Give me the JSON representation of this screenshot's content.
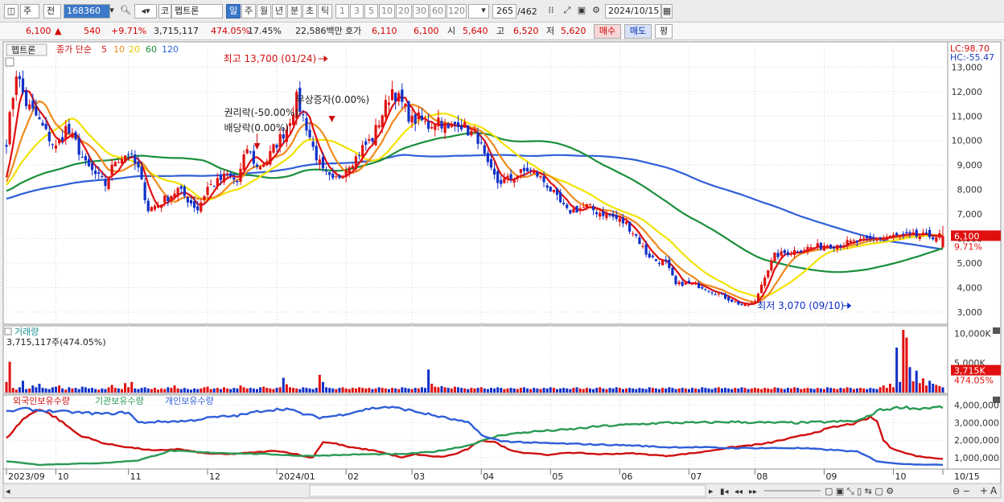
{
  "toolbar": {
    "market": "주",
    "type": "전",
    "code": "168360",
    "kind": "코",
    "name": "펩트론",
    "periods": [
      "일",
      "주",
      "월",
      "년",
      "분",
      "초",
      "틱"
    ],
    "minutes": [
      "1",
      "3",
      "5",
      "10",
      "20",
      "30",
      "60",
      "120"
    ],
    "count": "265",
    "total": "/462",
    "date": "2024/10/15"
  },
  "quote": {
    "price": "6,100",
    "arrow": "▲",
    "change": "540",
    "rate": "+9.71%",
    "volume": "3,715,117",
    "vol_ratio": "474.05%",
    "turnover": "17.45%",
    "amount": "22,586백만",
    "hoga_label": "호가",
    "ask": "6,110",
    "bid": "6,100",
    "open_label": "시",
    "open": "5,640",
    "high_label": "고",
    "high": "6,520",
    "low_label": "저",
    "low": "5,620",
    "buy": "매수",
    "sell": "매도",
    "eval": "평"
  },
  "legend": {
    "name": "펩트론",
    "ma_label": "종가 단순",
    "ma": [
      {
        "name": "5",
        "color": "#e01010"
      },
      {
        "name": "10",
        "color": "#f08a1c"
      },
      {
        "name": "20",
        "color": "#f2e200"
      },
      {
        "name": "60",
        "color": "#1a8f3a"
      },
      {
        "name": "120",
        "color": "#2f5fd8"
      }
    ]
  },
  "colors": {
    "up": "#e01010",
    "down": "#1030c8",
    "ma5": "#e01010",
    "ma10": "#f08a1c",
    "ma20": "#f2e200",
    "ma60": "#1a8f3a",
    "ma120": "#2f5fd8",
    "foreign": "#d01010",
    "inst": "#2a9a55",
    "retail": "#2f5fd8"
  },
  "chart_data": [
    {
      "type": "candlestick",
      "title": "",
      "ylim": [
        2600,
        13900
      ],
      "yticks": [
        "13,000",
        "12,000",
        "11,000",
        "10,000",
        "9,000",
        "8,000",
        "7,000",
        "6,000",
        "5,000",
        "4,000",
        "3,000"
      ],
      "ytick_values": [
        13000,
        12000,
        11000,
        10000,
        9000,
        8000,
        7000,
        6000,
        5000,
        4000,
        3000
      ],
      "x_months": [
        "2023/09",
        "10",
        "11",
        "12",
        "2024/01",
        "02",
        "03",
        "04",
        "05",
        "06",
        "07",
        "08",
        "09",
        "10",
        "10/15"
      ],
      "month_values": [
        0,
        15,
        37,
        61,
        82,
        103,
        123,
        144,
        165,
        186,
        207,
        227,
        248,
        269,
        284
      ],
      "price_anchors": {
        "x": [
          0,
          3,
          6,
          9,
          12,
          15,
          18,
          21,
          24,
          27,
          30,
          33,
          37,
          40,
          43,
          46,
          49,
          52,
          55,
          58,
          61,
          64,
          67,
          70,
          73,
          76,
          79,
          82,
          85,
          88,
          91,
          93,
          96,
          99,
          102,
          104,
          106,
          108,
          111,
          114,
          117,
          120,
          123,
          125,
          128,
          131,
          134,
          137,
          140,
          143,
          146,
          149,
          152,
          155,
          158,
          161,
          164,
          167,
          170,
          173,
          176,
          179,
          182,
          185,
          188,
          191,
          194,
          197,
          200,
          203,
          206,
          209,
          212,
          215,
          218,
          221,
          224,
          227,
          230,
          233,
          236,
          239,
          242,
          245,
          248,
          251,
          254,
          257,
          260,
          262,
          264,
          266,
          268,
          270,
          272,
          274,
          276,
          278
        ],
        "y": [
          10000,
          12800,
          11500,
          11000,
          10300,
          9700,
          10500,
          9900,
          9000,
          8600,
          8200,
          9200,
          9500,
          8800,
          7200,
          7400,
          7700,
          8000,
          7600,
          7200,
          8100,
          8300,
          8600,
          8300,
          9700,
          8900,
          9200,
          9900,
          10500,
          11700,
          10600,
          9700,
          8700,
          8300,
          8700,
          9100,
          9300,
          9700,
          10100,
          11100,
          12100,
          11500,
          10800,
          10900,
          10600,
          10900,
          10400,
          10800,
          10400,
          10100,
          8900,
          8300,
          8400,
          8600,
          8800,
          8600,
          8200,
          7600,
          7100,
          7200,
          7300,
          7100,
          7000,
          6800,
          6600,
          6100,
          5400,
          5100,
          5000,
          4100,
          4200,
          4100,
          4000,
          3800,
          3600,
          3400,
          3250,
          3400,
          4500,
          5300,
          5400,
          5500,
          5600,
          5650,
          5700,
          5750,
          5800,
          5850,
          5900,
          5950,
          6000,
          6050,
          6100,
          6080,
          6090,
          6100,
          6100,
          6100
        ]
      },
      "last_price": "6,100",
      "last_rate": "9.71%",
      "annotations": [
        {
          "text": "최고 13,700 (01/24)",
          "x": 97,
          "y": 13700,
          "value": 13700,
          "date": "01/24"
        },
        {
          "text": "무상증자(0.00%)",
          "x": 97,
          "y": 11900
        },
        {
          "text": "권리락(-50.00%)",
          "x": 76,
          "y": 10900
        },
        {
          "text": "배당락(0.00%)",
          "x": 76,
          "y": 10100
        },
        {
          "text": "최저 3,070 (09/10)",
          "x": 256,
          "y": 3070,
          "value": 3070,
          "date": "09/10"
        }
      ],
      "lc": "LC:98.70",
      "hc": "HC:-55.47",
      "series": [
        {
          "name": "5"
        },
        {
          "name": "10"
        },
        {
          "name": "20"
        },
        {
          "name": "60"
        },
        {
          "name": "120"
        }
      ]
    },
    {
      "type": "bar",
      "title": "거래량",
      "info": "3,715,117주(474.05%)",
      "yticks": [
        "10,000K",
        "5,000K"
      ],
      "ytick_values": [
        10000,
        5000
      ],
      "ylim": [
        0,
        10600
      ],
      "last_label": "3,715K",
      "last_rate": "474.05%",
      "values_k": [
        1800,
        5200,
        800,
        500,
        900,
        2000,
        600,
        700,
        1200,
        900,
        1500,
        800,
        700,
        600,
        900,
        1000,
        1200,
        700,
        500,
        900,
        700,
        800,
        600,
        1000,
        900,
        700,
        800,
        600,
        500,
        700,
        600,
        900,
        1300,
        800,
        700,
        600,
        1600,
        900,
        1800,
        700,
        600,
        800,
        900,
        700,
        600,
        800,
        500,
        700,
        600,
        900,
        800,
        1200,
        700,
        600,
        800,
        600,
        500,
        700,
        600,
        700,
        900,
        1000,
        600,
        700,
        800,
        600,
        900,
        700,
        600,
        800,
        700,
        1200,
        900,
        700,
        800,
        700,
        600,
        900,
        1000,
        800,
        700,
        600,
        800,
        900,
        2500,
        1400,
        900,
        800,
        700,
        600,
        900,
        800,
        700,
        600,
        800,
        3000,
        1800,
        900,
        800,
        700,
        600,
        800,
        900,
        700,
        600,
        800,
        700,
        900,
        800,
        700,
        800,
        600,
        700,
        900,
        800,
        700,
        600,
        800,
        700,
        600,
        900,
        800,
        700,
        600,
        800,
        700,
        900,
        800,
        3900,
        1500,
        1000,
        900,
        1100,
        900,
        800,
        700,
        1000,
        900,
        800,
        700,
        600,
        800,
        700,
        800,
        900,
        700,
        600,
        800,
        700,
        900,
        800,
        600,
        700,
        800,
        700,
        600,
        800,
        900,
        700,
        600,
        800,
        700,
        600,
        800,
        700,
        900,
        800,
        600,
        700,
        800,
        700,
        600,
        800,
        900,
        700,
        600,
        800,
        700,
        600,
        800,
        900,
        700,
        600,
        800,
        700,
        900,
        800,
        600,
        700,
        800,
        700,
        600,
        800,
        700,
        600,
        900,
        800,
        700,
        600,
        800,
        700,
        900,
        800,
        600,
        700,
        800,
        700,
        600,
        800,
        700,
        600,
        900,
        800,
        700,
        600,
        800,
        900,
        700,
        800,
        700,
        600,
        800,
        700,
        900,
        800,
        600,
        700,
        800,
        700,
        600,
        800,
        700,
        600,
        900,
        800,
        700,
        600,
        800,
        700,
        900,
        800,
        600,
        700,
        800,
        700,
        600,
        800,
        700,
        600,
        900,
        800,
        700,
        600,
        800,
        700,
        900,
        800,
        600,
        700,
        800,
        700,
        600,
        800,
        700,
        600,
        900,
        1200,
        800,
        1500,
        900,
        7600,
        1800,
        10600,
        9300,
        4300,
        1900,
        3700,
        1600,
        2400,
        1200,
        2000,
        1500,
        1300,
        1100,
        900,
        1000,
        1200,
        3715
      ]
    },
    {
      "type": "line",
      "title": "",
      "legend": [
        "외국인보유수량",
        "기관보유수량",
        "개인보유수량"
      ],
      "yticks": [
        "4,000,000",
        "3,000,000",
        "2,000,000",
        "1,000,000"
      ],
      "ytick_values": [
        4000000,
        3000000,
        2000000,
        1000000
      ],
      "ylim": [
        400000,
        4400000
      ],
      "series": [
        {
          "name": "외국인보유수량",
          "x": [
            0,
            5,
            10,
            15,
            22,
            30,
            37,
            45,
            52,
            60,
            67,
            75,
            82,
            88,
            92,
            93,
            96,
            100,
            104,
            108,
            112,
            116,
            120,
            124,
            128,
            132,
            136,
            140,
            144,
            148,
            152,
            156,
            160,
            165,
            170,
            180,
            190,
            200,
            210,
            220,
            230,
            240,
            250,
            258,
            262,
            264,
            266,
            268,
            272,
            276,
            280,
            284
          ],
          "y": [
            2100000,
            3200000,
            3800000,
            3300000,
            2300000,
            1800000,
            1600000,
            1400000,
            1500000,
            1250000,
            1200000,
            1300000,
            1400000,
            1200000,
            1000000,
            1050000,
            1900000,
            1800000,
            1600000,
            1500000,
            1400000,
            1200000,
            1000000,
            1200000,
            1100000,
            1050000,
            1200000,
            1500000,
            2000000,
            1900000,
            1500000,
            1300000,
            1250000,
            1150000,
            1300000,
            1200000,
            1250000,
            1100000,
            1300000,
            1600000,
            1800000,
            2200000,
            2700000,
            3000000,
            3300000,
            3100000,
            2000000,
            1600000,
            1300000,
            1100000,
            1000000,
            950000
          ]
        },
        {
          "name": "기관보유수량",
          "x": [
            0,
            10,
            20,
            30,
            40,
            50,
            60,
            70,
            80,
            90,
            100,
            110,
            120,
            130,
            140,
            150,
            160,
            170,
            180,
            190,
            200,
            210,
            220,
            230,
            240,
            250,
            258,
            262,
            264,
            268,
            272,
            276,
            280,
            284
          ],
          "y": [
            800000,
            600000,
            650000,
            700000,
            850000,
            1400000,
            1300000,
            1250000,
            1200000,
            1100000,
            1150000,
            1200000,
            1200000,
            1350000,
            1700000,
            2300000,
            2500000,
            2600000,
            2800000,
            2900000,
            3000000,
            3000000,
            3050000,
            3000000,
            3000000,
            3050000,
            3100000,
            3400000,
            3700000,
            3800000,
            3900000,
            3800000,
            3850000,
            3900000
          ]
        },
        {
          "name": "개인보유수량",
          "x": [
            0,
            5,
            10,
            20,
            30,
            37,
            40,
            45,
            55,
            62,
            70,
            78,
            85,
            90,
            95,
            100,
            105,
            110,
            115,
            120,
            125,
            130,
            135,
            140,
            145,
            150,
            160,
            170,
            180,
            190,
            200,
            210,
            220,
            230,
            240,
            250,
            258,
            262,
            264,
            268,
            272,
            276,
            280,
            284
          ],
          "y": [
            3600000,
            3800000,
            3700000,
            3600000,
            3500000,
            3600000,
            3000000,
            3050000,
            3100000,
            3300000,
            3400000,
            3700000,
            3800000,
            3500000,
            3300000,
            3400000,
            3600000,
            3800000,
            3900000,
            3800000,
            3600000,
            3400000,
            3200000,
            3000000,
            2200000,
            1950000,
            1850000,
            1800000,
            1750000,
            1700000,
            1600000,
            1600000,
            1550000,
            1550000,
            1550000,
            1450000,
            1350000,
            1000000,
            800000,
            700000,
            650000,
            620000,
            600000,
            600000
          ]
        }
      ]
    }
  ]
}
